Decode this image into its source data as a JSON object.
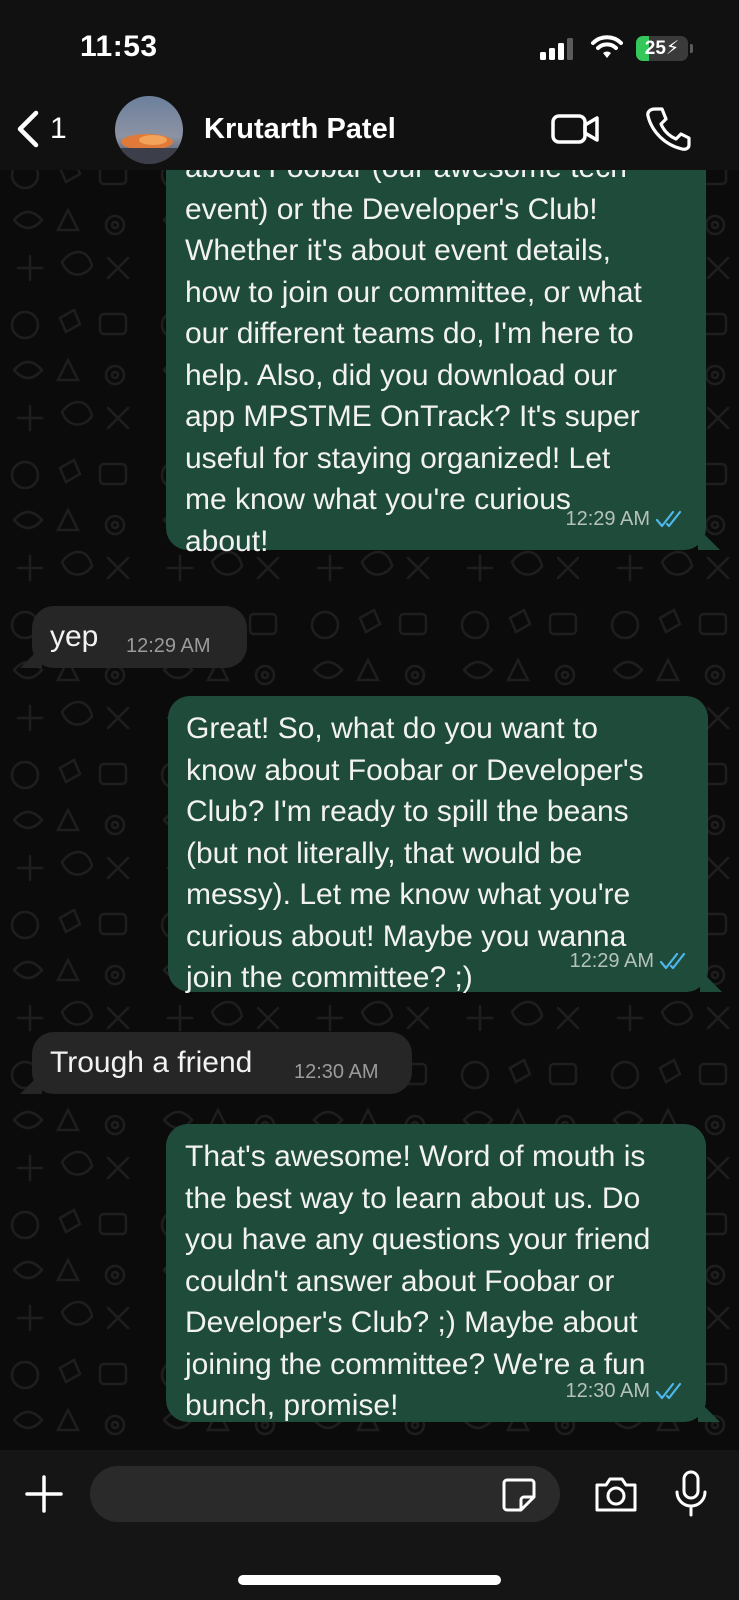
{
  "status_bar": {
    "time": "11:53",
    "battery_level": "25",
    "battery_fraction": 0.25,
    "battery_color": "#34c759"
  },
  "header": {
    "back_count": "1",
    "contact_name": "Krutarth Patel",
    "video_icon": "video-camera-icon",
    "call_icon": "phone-icon"
  },
  "colors": {
    "outgoing_bubble": "#1f4b3a",
    "incoming_bubble": "#262626",
    "read_ticks": "#4fb6ec"
  },
  "messages": [
    {
      "direction": "outgoing",
      "text": "about Foobar (our awesome tech\nevent) or the Developer's Club!\nWhether it's about event details,\nhow to join our committee, or what\nour different teams do, I'm here to\nhelp. Also, did you download our\napp MPSTME OnTrack? It's super\nuseful for staying organized! Let\nme know what you're curious\nabout!",
      "time": "12:29 AM",
      "status": "read"
    },
    {
      "direction": "incoming",
      "text": "yep",
      "time": "12:29 AM"
    },
    {
      "direction": "outgoing",
      "text": "Great! So, what do you want to\nknow about Foobar or Developer's\nClub? I'm ready to spill the beans\n(but not literally, that would be\nmessy). Let me know what you're\ncurious about! Maybe you wanna\njoin the committee? ;)",
      "time": "12:29 AM",
      "status": "read"
    },
    {
      "direction": "incoming",
      "text": "Trough a friend",
      "time": "12:30 AM"
    },
    {
      "direction": "outgoing",
      "text": "That's awesome! Word of mouth is\nthe best way to learn about us. Do\nyou have any questions your friend\ncouldn't answer about Foobar or\nDeveloper's Club? ;) Maybe about\njoining the committee? We're a fun\nbunch, promise!",
      "time": "12:30 AM",
      "status": "read"
    }
  ],
  "composer": {
    "input_value": "",
    "plus_icon": "plus-icon",
    "sticker_icon": "sticker-icon",
    "camera_icon": "camera-icon",
    "mic_icon": "microphone-icon"
  }
}
